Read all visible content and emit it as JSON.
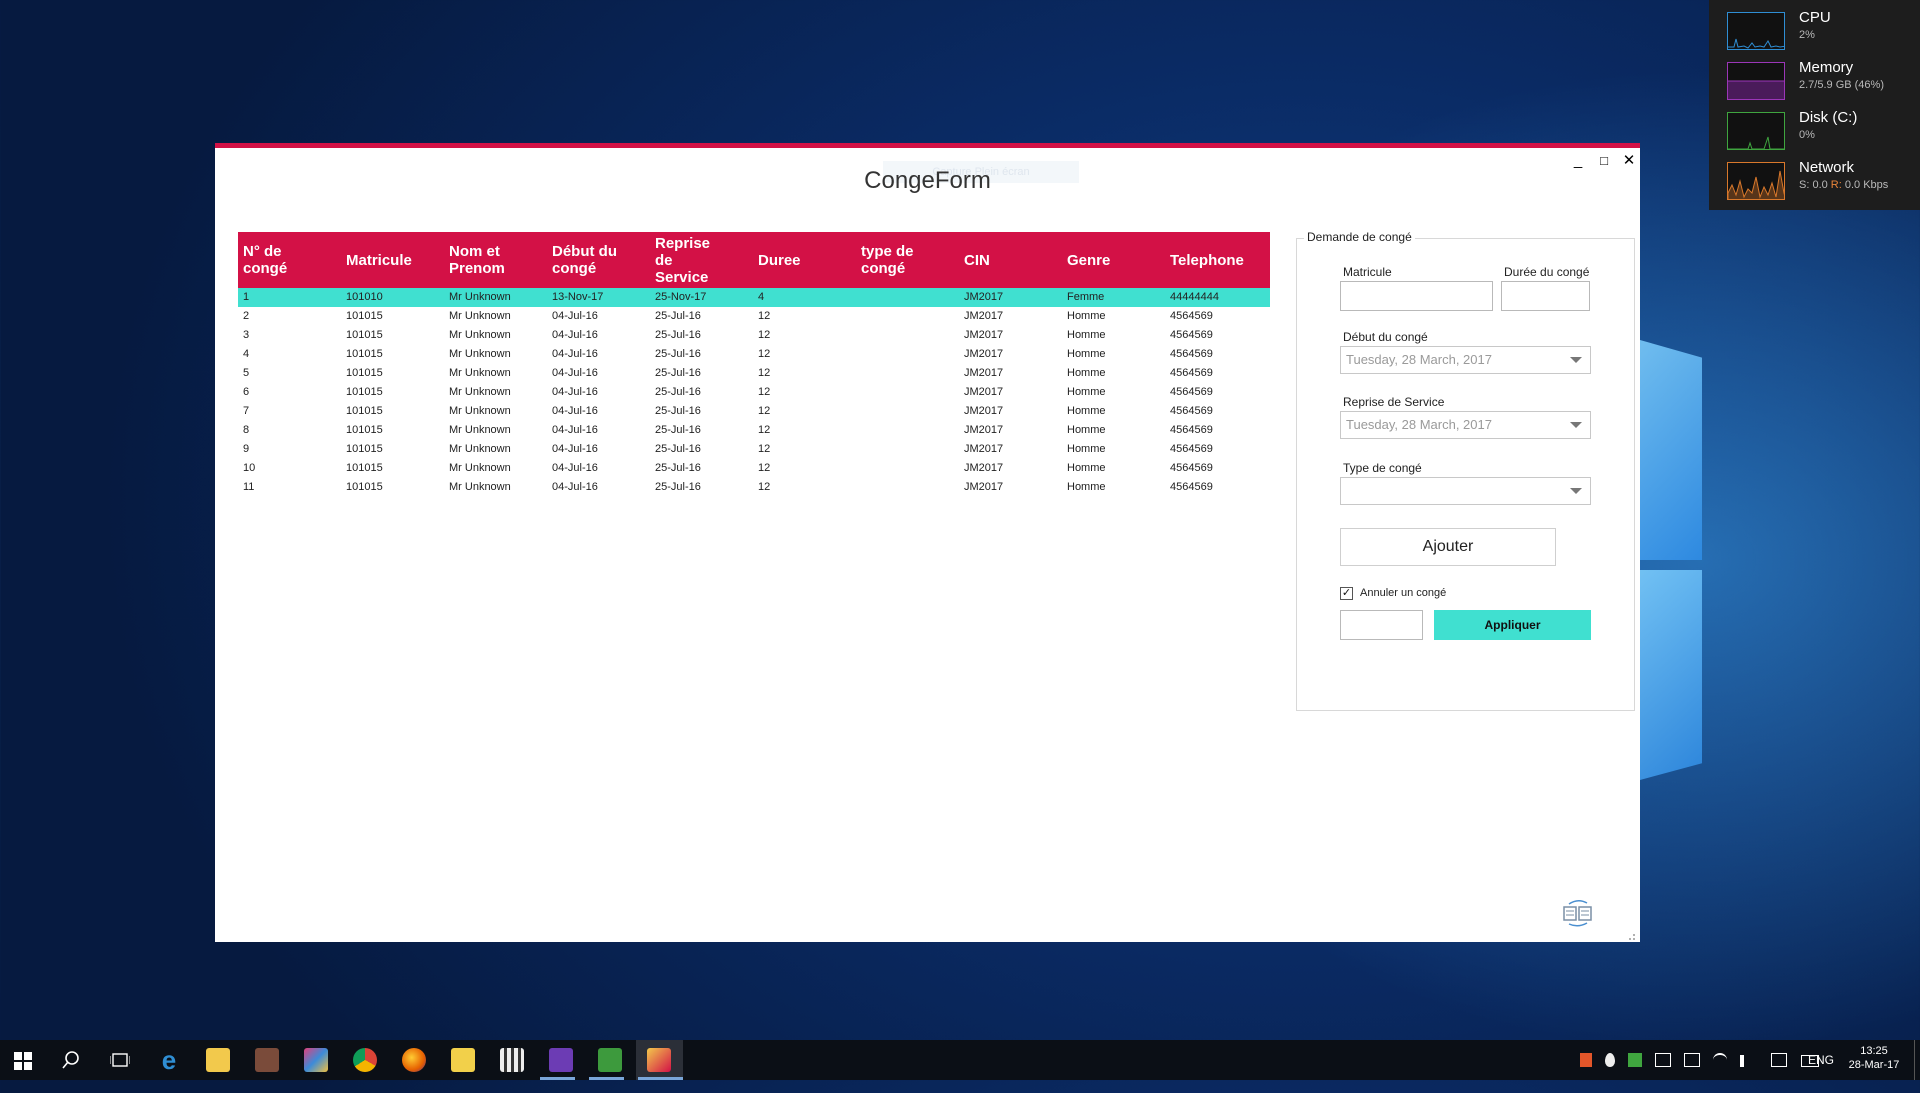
{
  "window": {
    "title": "CongeForm",
    "ghost_text": "Capture Plein écran",
    "minimize_label": "_",
    "maximize_label": "□",
    "close_label": "✕"
  },
  "grid": {
    "columns": [
      "N° de congé",
      "Matricule",
      "Nom et Prenom",
      "Début du congé",
      "Reprise de Service",
      "Duree",
      "type de congé",
      "CIN",
      "Genre",
      "Telephone"
    ],
    "rows": [
      [
        "1",
        "101010",
        "Mr Unknown",
        "13-Nov-17",
        "25-Nov-17",
        "4",
        "",
        "JM2017",
        "Femme",
        "44444444"
      ],
      [
        "2",
        "101015",
        "Mr Unknown",
        "04-Jul-16",
        "25-Jul-16",
        "12",
        "",
        "JM2017",
        "Homme",
        "4564569"
      ],
      [
        "3",
        "101015",
        "Mr Unknown",
        "04-Jul-16",
        "25-Jul-16",
        "12",
        "",
        "JM2017",
        "Homme",
        "4564569"
      ],
      [
        "4",
        "101015",
        "Mr Unknown",
        "04-Jul-16",
        "25-Jul-16",
        "12",
        "",
        "JM2017",
        "Homme",
        "4564569"
      ],
      [
        "5",
        "101015",
        "Mr Unknown",
        "04-Jul-16",
        "25-Jul-16",
        "12",
        "",
        "JM2017",
        "Homme",
        "4564569"
      ],
      [
        "6",
        "101015",
        "Mr Unknown",
        "04-Jul-16",
        "25-Jul-16",
        "12",
        "",
        "JM2017",
        "Homme",
        "4564569"
      ],
      [
        "7",
        "101015",
        "Mr Unknown",
        "04-Jul-16",
        "25-Jul-16",
        "12",
        "",
        "JM2017",
        "Homme",
        "4564569"
      ],
      [
        "8",
        "101015",
        "Mr Unknown",
        "04-Jul-16",
        "25-Jul-16",
        "12",
        "",
        "JM2017",
        "Homme",
        "4564569"
      ],
      [
        "9",
        "101015",
        "Mr Unknown",
        "04-Jul-16",
        "25-Jul-16",
        "12",
        "",
        "JM2017",
        "Homme",
        "4564569"
      ],
      [
        "10",
        "101015",
        "Mr Unknown",
        "04-Jul-16",
        "25-Jul-16",
        "12",
        "",
        "JM2017",
        "Homme",
        "4564569"
      ],
      [
        "11",
        "101015",
        "Mr Unknown",
        "04-Jul-16",
        "25-Jul-16",
        "12",
        "",
        "JM2017",
        "Homme",
        "4564569"
      ]
    ],
    "selected_row": 0
  },
  "form": {
    "group_title": "Demande de congé",
    "matricule_label": "Matricule",
    "duree_label": "Durée du congé",
    "debut_label": "Début du congé",
    "debut_value": "Tuesday, 28 March, 2017",
    "reprise_label": "Reprise de Service",
    "reprise_value": "Tuesday, 28 March, 2017",
    "type_label": "Type de congé",
    "ajouter_label": "Ajouter",
    "annuler_label": "Annuler un congé",
    "annuler_checked": true,
    "appliquer_label": "Appliquer"
  },
  "sysmon": [
    {
      "title": "CPU",
      "sub": "2%",
      "color": "#2f8ed4"
    },
    {
      "title": "Memory",
      "sub": "2.7/5.9 GB (46%)",
      "color": "#9b36b8"
    },
    {
      "title": "Disk (C:)",
      "sub": "0%",
      "color": "#3fa53f"
    },
    {
      "title": "Network",
      "sub_s": "S: 0.0 ",
      "sub_r_label": "R:",
      "sub_r": " 0.0 Kbps",
      "color": "#d9782b"
    }
  ],
  "taskbar": {
    "language": "ENG",
    "time": "13:25",
    "date": "28-Mar-17"
  },
  "colors": {
    "accent": "#d31146",
    "selection": "#40e0d0"
  }
}
